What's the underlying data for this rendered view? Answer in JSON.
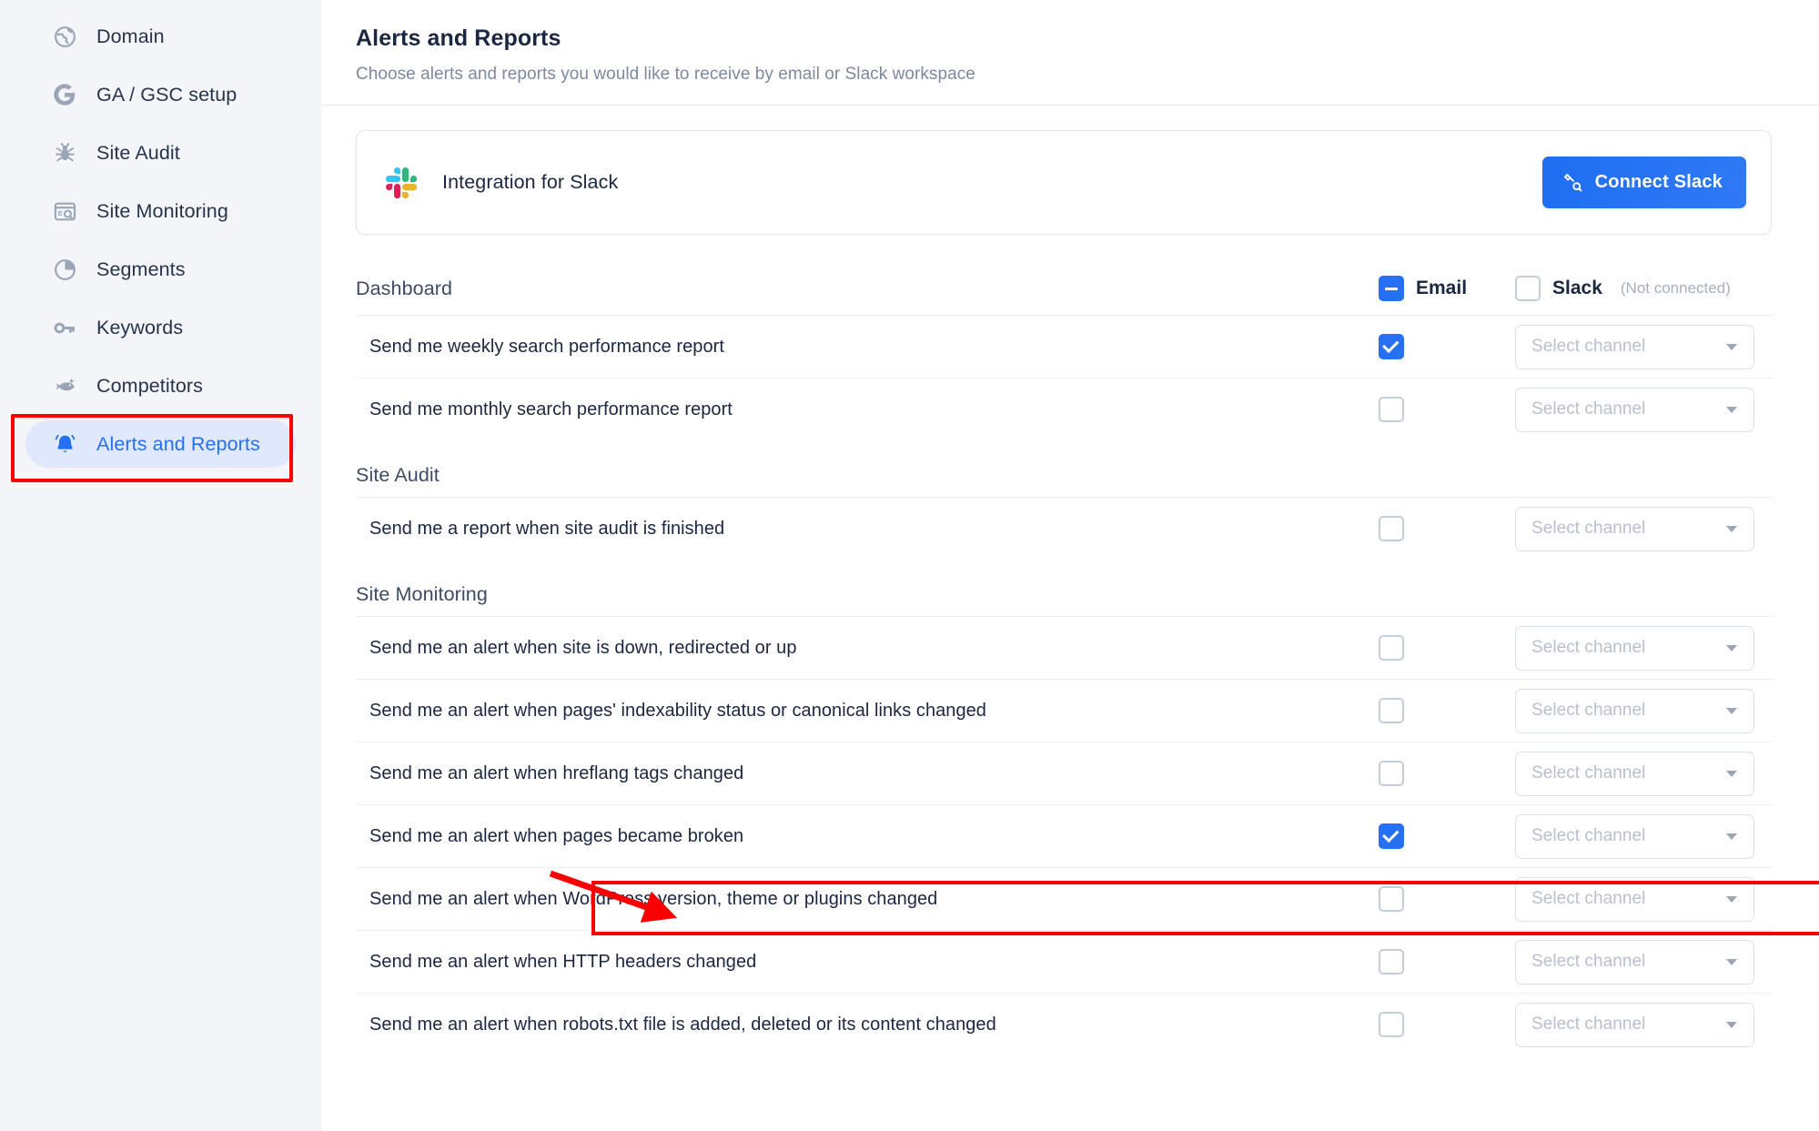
{
  "colors": {
    "accent": "#2570f4",
    "highlight": "#fb0000",
    "text_dark": "#1b2640",
    "text_muted": "#7d899e",
    "sidebar_bg": "#f3f5f9",
    "active_nav_bg": "#dfe8fd"
  },
  "sidebar": {
    "items": [
      {
        "label": "Domain",
        "icon": "globe-icon",
        "active": false
      },
      {
        "label": "GA / GSC setup",
        "icon": "google-g-icon",
        "active": false
      },
      {
        "label": "Site Audit",
        "icon": "bug-icon",
        "active": false
      },
      {
        "label": "Site Monitoring",
        "icon": "monitor-search-icon",
        "active": false
      },
      {
        "label": "Segments",
        "icon": "pie-chart-icon",
        "active": false
      },
      {
        "label": "Keywords",
        "icon": "key-icon",
        "active": false
      },
      {
        "label": "Competitors",
        "icon": "fish-icon",
        "active": false
      },
      {
        "label": "Alerts and Reports",
        "icon": "bell-icon",
        "active": true
      }
    ]
  },
  "header": {
    "title": "Alerts and Reports",
    "subtitle": "Choose alerts and reports you would like to receive by email or Slack workspace"
  },
  "slack_card": {
    "icon": "slack-logo-icon",
    "title": "Integration for Slack",
    "button_label": "Connect Slack",
    "button_icon": "connect-plug-icon"
  },
  "columns": {
    "email": {
      "label": "Email",
      "state": "indeterminate"
    },
    "slack": {
      "label": "Slack",
      "note": "(Not connected)",
      "state": "unchecked"
    }
  },
  "channel_placeholder": "Select channel",
  "sections": [
    {
      "name": "Dashboard",
      "is_header_row": true,
      "rows": [
        {
          "label": "Send me weekly search performance report",
          "email": "checked",
          "slack": "unchecked",
          "channel": "Select channel",
          "highlighted": false
        },
        {
          "label": "Send me monthly search performance report",
          "email": "unchecked",
          "slack": "unchecked",
          "channel": "Select channel",
          "highlighted": false
        }
      ]
    },
    {
      "name": "Site Audit",
      "is_header_row": false,
      "rows": [
        {
          "label": "Send me a report when site audit is finished",
          "email": "unchecked",
          "slack": "unchecked",
          "channel": "Select channel",
          "highlighted": false
        }
      ]
    },
    {
      "name": "Site Monitoring",
      "is_header_row": false,
      "rows": [
        {
          "label": "Send me an alert when site is down, redirected or up",
          "email": "unchecked",
          "slack": "unchecked",
          "channel": "Select channel",
          "highlighted": false
        },
        {
          "label": "Send me an alert when pages' indexability status or canonical links changed",
          "email": "unchecked",
          "slack": "unchecked",
          "channel": "Select channel",
          "highlighted": false
        },
        {
          "label": "Send me an alert when hreflang tags changed",
          "email": "unchecked",
          "slack": "unchecked",
          "channel": "Select channel",
          "highlighted": false
        },
        {
          "label": "Send me an alert when pages became broken",
          "email": "checked",
          "slack": "unchecked",
          "channel": "Select channel",
          "highlighted": true
        },
        {
          "label": "Send me an alert when WordPress version, theme or plugins changed",
          "email": "unchecked",
          "slack": "unchecked",
          "channel": "Select channel",
          "highlighted": false
        },
        {
          "label": "Send me an alert when HTTP headers changed",
          "email": "unchecked",
          "slack": "unchecked",
          "channel": "Select channel",
          "highlighted": false
        },
        {
          "label": "Send me an alert when robots.txt file is added, deleted or its content changed",
          "email": "unchecked",
          "slack": "unchecked",
          "channel": "Select channel",
          "highlighted": false
        }
      ]
    }
  ],
  "annotations": {
    "nav_highlight_target": "Alerts and Reports",
    "row_highlight_target": "Send me an alert when pages became broken",
    "arrow": "red-arrow-pointing-right"
  }
}
